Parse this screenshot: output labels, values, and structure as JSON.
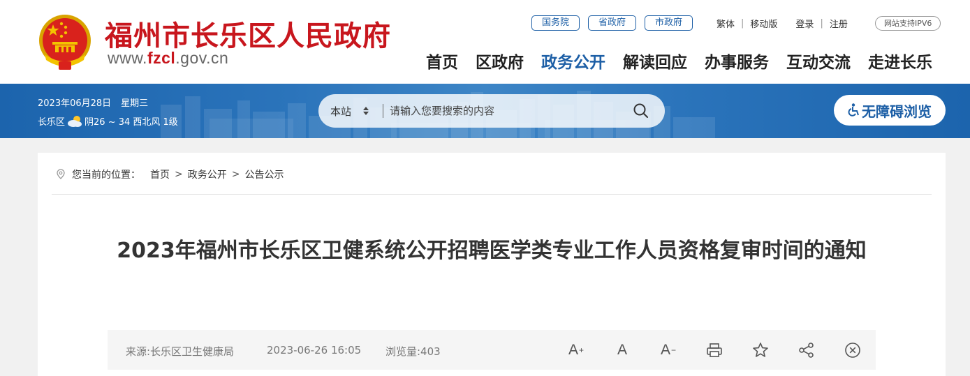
{
  "header": {
    "title": "福州市长乐区人民政府",
    "url_prefix": "www.",
    "url_highlight": "fzcl",
    "url_suffix": ".gov.cn",
    "gov_links": [
      "国务院",
      "省政府",
      "市政府"
    ],
    "util_links": {
      "traditional": "繁体",
      "mobile": "移动版",
      "login": "登录",
      "register": "注册"
    },
    "ipv6_badge": "网站支持IPV6",
    "nav": [
      "首页",
      "区政府",
      "政务公开",
      "解读回应",
      "办事服务",
      "互动交流",
      "走进长乐"
    ],
    "active_nav": "政务公开",
    "brand_color": "#c8161d",
    "accent_color": "#1d5fa6"
  },
  "banner": {
    "date": "2023年06月28日",
    "weekday": "星期三",
    "district": "长乐区",
    "weather": "阴26 ~ 34 西北风 1级",
    "weather_icon": "cloudy-sun-icon",
    "search": {
      "scope": "本站",
      "placeholder": "请输入您要搜索的内容",
      "icon": "search-icon"
    },
    "accessibility_label": "无障碍浏览"
  },
  "breadcrumb": {
    "prefix": "您当前的位置：",
    "items": [
      "首页",
      "政务公开",
      "公告公示"
    ]
  },
  "article": {
    "title": "2023年福州市长乐区卫健系统公开招聘医学类专业工作人员资格复审时间的通知",
    "source": "来源:长乐区卫生健康局",
    "time": "2023-06-26 16:05",
    "views": "浏览量:403",
    "tools": {
      "font_larger": "A",
      "font_normal": "A",
      "font_smaller": "A"
    }
  }
}
